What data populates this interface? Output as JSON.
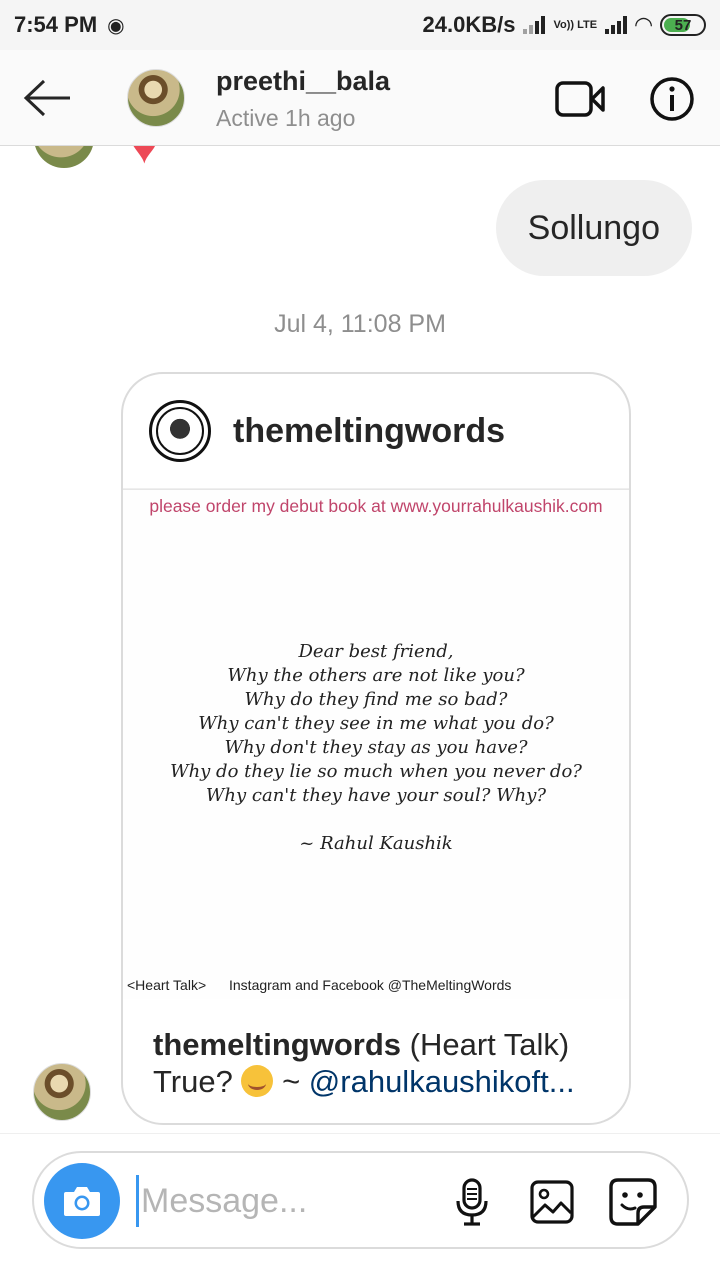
{
  "status_bar": {
    "time": "7:54 PM",
    "network_speed": "24.0KB/s",
    "volte": "Vo)) LTE",
    "battery": "57"
  },
  "header": {
    "username": "preethi__bala",
    "status": "Active 1h ago"
  },
  "messages": {
    "sent_text": "Sollungo",
    "timestamp": "Jul 4, 11:08 PM"
  },
  "shared_post": {
    "account": "themeltingwords",
    "promo": "please order my debut book at www.yourrahulkaushik.com",
    "poem_lines": [
      "Dear best friend,",
      "Why the others are not like you?",
      "Why do they find me so bad?",
      "Why can't they see in me what you do?",
      "Why don't they stay as you have?",
      "Why do they lie so much when you never do?",
      "Why can't they have your soul? Why?"
    ],
    "signature": "~ Rahul Kaushik",
    "footer_left": "<Heart Talk>",
    "footer_right": "Instagram and Facebook @TheMeltingWords",
    "caption_user": "themeltingwords",
    "caption_text": " (Heart Talk)",
    "caption_line2_pre": "True? ",
    "caption_line2_mid": " ~ ",
    "caption_mention": "@rahulkaushikoft..."
  },
  "composer": {
    "placeholder": "Message..."
  }
}
